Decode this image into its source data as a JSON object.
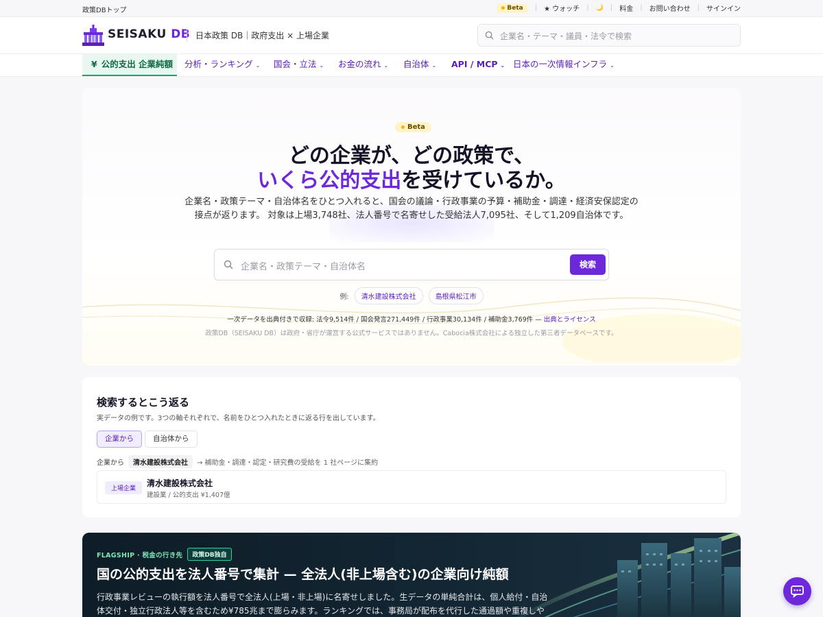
{
  "utilbar": {
    "home": "政策DBトップ",
    "beta": "Beta",
    "watch": "★ ウォッチ",
    "moon": "🌙",
    "pricing": "料金",
    "contact": "お問い合わせ",
    "signin": "サインイン"
  },
  "header": {
    "logo_main": "SEISAKU",
    "logo_db": "DB",
    "tagline": "日本政策 DB｜政府支出 × 上場企業",
    "search_placeholder": "企業名・テーマ・議員・法令で検索"
  },
  "nav": {
    "active_icon": "¥",
    "items": [
      {
        "label": "公的支出 企業純額"
      },
      {
        "label": "分析・ランキング"
      },
      {
        "label": "国会・立法"
      },
      {
        "label": "お金の流れ"
      },
      {
        "label": "自治体"
      },
      {
        "label": "API / MCP"
      },
      {
        "label": "日本の一次情報インフラ"
      }
    ]
  },
  "hero": {
    "beta": "Beta",
    "title_line1": "どの企業が、どの政策で、",
    "title_accent": "いくら公的支出",
    "title_line2_rest": "を受けているか。",
    "lead": "企業名・政策テーマ・自治体名をひとつ入れると、国会の議論・行政事業の予算・補助金・調達・経済安保認定の接点が返ります。 対象は上場3,748社、法人番号で名寄せした受給法人7,095社、そして1,209自治体です。",
    "search_placeholder": "企業名・政策テーマ・自治体名",
    "search_button": "検索",
    "examples_label": "例:",
    "examples": [
      "清水建設株式会社",
      "島根県松江市"
    ],
    "stats": "一次データを出典付きで収録: 法令9,514件 / 国会発言271,449件 / 行政事業30,134件 / 補助金3,769件 —",
    "stats_link": "出典とライセンス",
    "disclaimer": "政策DB（SEISAKU DB）は政府・省庁が運営する公式サービスではありません。Cabocia株式会社による独立した第三者データベースです。"
  },
  "sample": {
    "title": "検索するとこう返る",
    "subtitle": "実データの例です。3つの軸それぞれで、名前をひとつ入れたときに返る行を出しています。",
    "tabs": [
      "企業から",
      "自治体から"
    ],
    "crumb_label": "企業から",
    "crumb_company": "清水建設株式会社",
    "crumb_desc": "→ 補助金・調達・認定・研究費の受給を 1 社ページに集約",
    "result": {
      "tag": "上場企業",
      "name": "清水建設株式会社",
      "meta": "建設業 / 公的支出 ¥1,407億"
    }
  },
  "flagship": {
    "kicker": "FLAGSHIP · 税金の行き先",
    "pill": "政策DB独自",
    "title": "国の公的支出を法人番号で集計 — 全法人(非上場含む)の企業向け純額",
    "body": "行政事業レビューの執行額を法人番号で全法人(上場・非上場)に名寄せしました。生データの単純合計は、個人給付・自治体交付・独立行政法人等を含むため¥785兆まで膨らみます。ランキングでは、事務局が配布を代行した通過額や重複しや"
  },
  "colors": {
    "accent": "#6d28d9",
    "active_nav": "#10a86a",
    "beta_bg": "#fff3c7"
  }
}
